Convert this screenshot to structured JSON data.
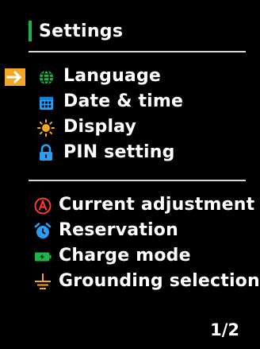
{
  "header": {
    "title": "Settings",
    "accent_color": "#22b24c"
  },
  "menu": {
    "selected_index": 0,
    "selector_icon": "arrow-right-icon",
    "selector_color": "#f5a623",
    "group1": [
      {
        "label": "Language",
        "icon": "globe-icon",
        "icon_color": "#22b24c"
      },
      {
        "label": "Date & time",
        "icon": "calendar-icon",
        "icon_color": "#2a9df4"
      },
      {
        "label": "Display",
        "icon": "sun-icon",
        "icon_color": "#f5a623"
      },
      {
        "label": "PIN setting",
        "icon": "lock-icon",
        "icon_color": "#2a9df4"
      }
    ],
    "group2": [
      {
        "label": "Current adjustment",
        "icon": "current-a-icon",
        "icon_color": "#ff3b30"
      },
      {
        "label": "Reservation",
        "icon": "alarm-clock-icon",
        "icon_color": "#2a9df4"
      },
      {
        "label": "Charge mode",
        "icon": "battery-icon",
        "icon_color": "#22b24c"
      },
      {
        "label": "Grounding selection",
        "icon": "ground-icon",
        "icon_color": "#f5a623"
      }
    ]
  },
  "pagination": {
    "text": "1/2"
  }
}
